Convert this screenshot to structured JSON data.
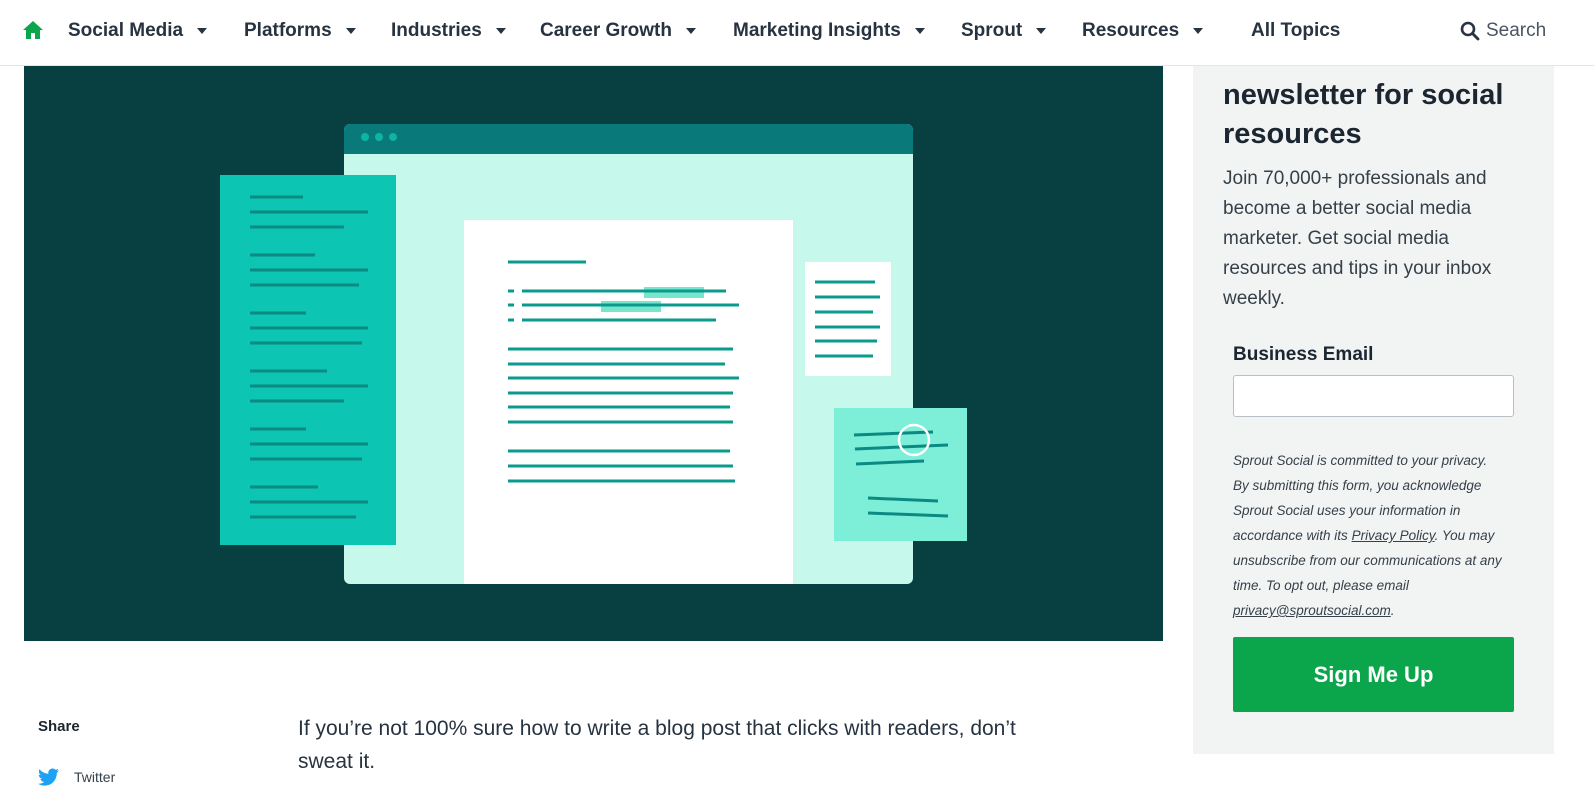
{
  "nav": {
    "home_icon": "home-icon",
    "items": [
      {
        "label": "Social Media"
      },
      {
        "label": "Platforms"
      },
      {
        "label": "Industries"
      },
      {
        "label": "Career Growth"
      },
      {
        "label": "Marketing Insights"
      },
      {
        "label": "Sprout"
      },
      {
        "label": "Resources"
      }
    ],
    "all_topics": "All Topics",
    "search_label": "Search"
  },
  "colors": {
    "brand_green": "#0ba64b",
    "hero_bg": "#083f41",
    "teal": "#0cc6b3",
    "mint": "#c6f9ec"
  },
  "sidebar": {
    "title": "newsletter for social resources",
    "description": "Join 70,000+ professionals and become a better social media marketer. Get social media resources and tips in your inbox weekly.",
    "email_label": "Business Email",
    "email_value": "",
    "privacy_1": "Sprout Social is committed to your privacy. By submitting this form, you acknowledge Sprout Social uses your information in accordance with its ",
    "privacy_link": "Privacy Policy",
    "privacy_2": ". You may unsubscribe from our communications at any time. To opt out, please email ",
    "privacy_email": "privacy@sproutsocial.com",
    "privacy_3": ".",
    "button_label": "Sign Me Up"
  },
  "article": {
    "share_label": "Share",
    "share_twitter": "Twitter",
    "intro": "If you’re not 100% sure how to write a blog post that clicks with readers, don’t sweat it."
  }
}
